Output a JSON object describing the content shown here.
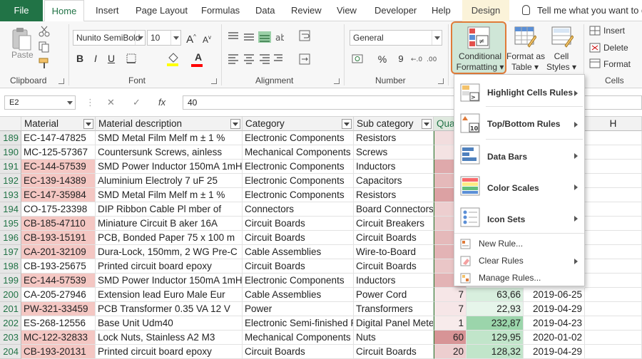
{
  "tabs": {
    "file": "File",
    "items": [
      "Home",
      "Insert",
      "Page Layout",
      "Formulas",
      "Data",
      "Review",
      "View",
      "Developer",
      "Help",
      "Design"
    ],
    "active": "Home",
    "tell_me": "Tell me what you want to do"
  },
  "ribbon": {
    "clipboard": {
      "label": "Clipboard",
      "paste": "Paste"
    },
    "font": {
      "label": "Font",
      "name": "Nunito SemiBold",
      "size": "10",
      "grow": "A",
      "shrink": "A",
      "bold": "B",
      "italic": "I",
      "underline": "U",
      "font_color": "A"
    },
    "alignment": {
      "label": "Alignment"
    },
    "number": {
      "label": "Number",
      "format": "General",
      "currency": "$",
      "percent": "%",
      "comma": "9"
    },
    "styles": {
      "conditional_formatting": [
        "Conditional",
        "Formatting"
      ],
      "format_as_table": [
        "Format as",
        "Table"
      ],
      "cell_styles": [
        "Cell",
        "Styles"
      ]
    },
    "cells": {
      "label": "Cells",
      "insert": "Insert",
      "delete": "Delete",
      "format": "Format"
    }
  },
  "formula_bar": {
    "name_box": "E2",
    "cancel": "✕",
    "enter": "✓",
    "fx": "fx",
    "value": "40"
  },
  "columns": [
    {
      "key": "A",
      "label": "Material",
      "filter": true
    },
    {
      "key": "B",
      "label": "Material description",
      "filter": true
    },
    {
      "key": "C",
      "label": "Category",
      "filter": true
    },
    {
      "key": "D",
      "label": "Sub category",
      "filter": true
    },
    {
      "key": "E",
      "label": "Qua",
      "filter": false
    },
    {
      "key": "H",
      "label": "H",
      "filter": false
    }
  ],
  "rows": [
    {
      "n": "189",
      "material": "EC-147-47825",
      "desc": "SMD Metal Film Melf m ± 1 %",
      "cat": "Electronic Components",
      "sub": "Resistors",
      "hl": false
    },
    {
      "n": "190",
      "material": "MC-125-57367",
      "desc": "Countersunk Screws, ainless",
      "cat": "Mechanical Components",
      "sub": "Screws",
      "hl": false
    },
    {
      "n": "191",
      "material": "EC-144-57539",
      "desc": "SMD Power Inductor 150mA 1mH",
      "cat": "Electronic Components",
      "sub": "Inductors",
      "hl": true
    },
    {
      "n": "192",
      "material": "EC-139-14389",
      "desc": "Aluminium Electroly 7 uF 25",
      "cat": "Electronic Components",
      "sub": "Capacitors",
      "hl": true
    },
    {
      "n": "193",
      "material": "EC-147-35984",
      "desc": "SMD Metal Film Melf m ± 1 %",
      "cat": "Electronic Components",
      "sub": "Resistors",
      "hl": true
    },
    {
      "n": "194",
      "material": "CO-175-23398",
      "desc": "DIP Ribbon Cable Pl mber of",
      "cat": "Connectors",
      "sub": "Board Connectors",
      "hl": false
    },
    {
      "n": "195",
      "material": "CB-185-47110",
      "desc": "Miniature Circuit B aker 16A",
      "cat": "Circuit Boards",
      "sub": "Circuit Breakers",
      "hl": true
    },
    {
      "n": "196",
      "material": "CB-193-15191",
      "desc": "PCB, Bonded Paper 75 x 100 m",
      "cat": "Circuit Boards",
      "sub": "Circuit Boards",
      "hl": true
    },
    {
      "n": "197",
      "material": "CA-201-32109",
      "desc": "Dura-Lock, 150mm, 2 WG Pre-C",
      "cat": "Cable Assemblies",
      "sub": "Wire-to-Board",
      "hl": true
    },
    {
      "n": "198",
      "material": "CB-193-25675",
      "desc": "Printed circuit board epoxy",
      "cat": "Circuit Boards",
      "sub": "Circuit Boards",
      "hl": false
    },
    {
      "n": "199",
      "material": "EC-144-57539",
      "desc": "SMD Power Inductor 150mA 1mH",
      "cat": "Electronic Components",
      "sub": "Inductors",
      "hl": true
    },
    {
      "n": "200",
      "material": "CA-205-27946",
      "desc": "Extension lead Euro Male Eur",
      "cat": "Cable Assemblies",
      "sub": "Power Cord",
      "hl": false,
      "qty": "7",
      "price": "63,66",
      "date": "2019-06-25"
    },
    {
      "n": "201",
      "material": "PW-321-33459",
      "desc": "PCB Transformer 0.35 VA 12 V",
      "cat": "Power",
      "sub": "Transformers",
      "hl": true,
      "qty": "7",
      "price": "22,93",
      "date": "2019-04-29"
    },
    {
      "n": "202",
      "material": "ES-268-12556",
      "desc": "Base Unit Udm40",
      "cat": "Electronic Semi-finished Pi",
      "sub": "Digital Panel Mete",
      "hl": false,
      "qty": "1",
      "price": "232,87",
      "date": "2019-04-23"
    },
    {
      "n": "203",
      "material": "MC-122-32833",
      "desc": "Lock Nuts, Stainless A2 M3",
      "cat": "Mechanical Components",
      "sub": "Nuts",
      "hl": true,
      "qty": "60",
      "price": "129,95",
      "date": "2020-01-02"
    },
    {
      "n": "204",
      "material": "CB-193-20131",
      "desc": "Printed circuit board epoxy",
      "cat": "Circuit Boards",
      "sub": "Circuit Boards",
      "hl": true,
      "qty": "20",
      "price": "128,32",
      "date": "2019-04-29"
    }
  ],
  "qty_scale": [
    0.15,
    0.1,
    0.7,
    0.55,
    0.8,
    0.3,
    0.35,
    0.55,
    0.6,
    0.4,
    0.6,
    0.05,
    0.05,
    0.0,
    0.95,
    0.3
  ],
  "price_scale": [
    0,
    0,
    0,
    0,
    0,
    0,
    0,
    0,
    0,
    0,
    0,
    0.25,
    0.1,
    0.9,
    0.5,
    0.5
  ],
  "cf_menu": {
    "items": [
      {
        "label": "Highlight Cells Rules",
        "icon": "highlight-cells-icon"
      },
      {
        "label": "Top/Bottom Rules",
        "icon": "top-bottom-icon"
      },
      {
        "label": "Data Bars",
        "icon": "data-bars-icon"
      },
      {
        "label": "Color Scales",
        "icon": "color-scales-icon"
      },
      {
        "label": "Icon Sets",
        "icon": "icon-sets-icon"
      }
    ],
    "actions": [
      {
        "label": "New Rule...",
        "arrow": false
      },
      {
        "label": "Clear Rules",
        "arrow": true
      },
      {
        "label": "Manage Rules...",
        "arrow": false
      }
    ]
  },
  "colors": {
    "excel_green": "#217346",
    "highlight_red": "#f4c7c3",
    "cf_border": "#e07b39",
    "qty_red": "#c0575b",
    "price_green": "#63be7b"
  }
}
